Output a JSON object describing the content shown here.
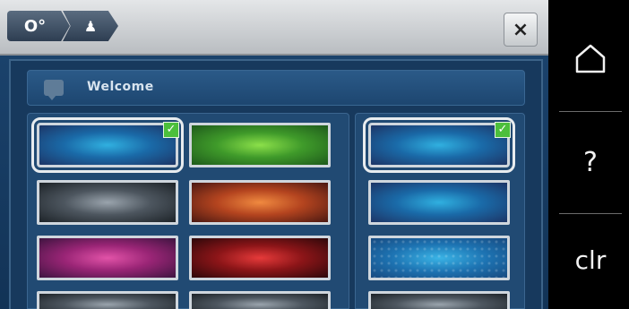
{
  "topbar": {
    "crumbs": [
      {
        "icon": "machine-settings-icon",
        "glyph": "O°"
      },
      {
        "icon": "user-icon",
        "glyph": "♟"
      }
    ],
    "close_label": "×"
  },
  "welcome": {
    "icon": "speech-bubble-icon",
    "text": "Welcome"
  },
  "themes": {
    "left": [
      {
        "name": "blue",
        "selected": true
      },
      {
        "name": "green",
        "selected": false
      },
      {
        "name": "gray",
        "selected": false
      },
      {
        "name": "orange",
        "selected": false
      },
      {
        "name": "pink",
        "selected": false
      },
      {
        "name": "red",
        "selected": false
      }
    ],
    "right": [
      {
        "name": "blue",
        "selected": true
      },
      {
        "name": "blue",
        "selected": false
      },
      {
        "name": "blue-dots",
        "selected": false
      }
    ],
    "check_glyph": "✓"
  },
  "sidebar": {
    "home_icon": "home-icon",
    "help_label": "?",
    "clear_label": "clr"
  },
  "colors": {
    "panel_bg": "#1c4570",
    "topbar_bg": "#d8dbde",
    "check_green": "#4cbf3c",
    "sidebar_bg": "#000000"
  }
}
